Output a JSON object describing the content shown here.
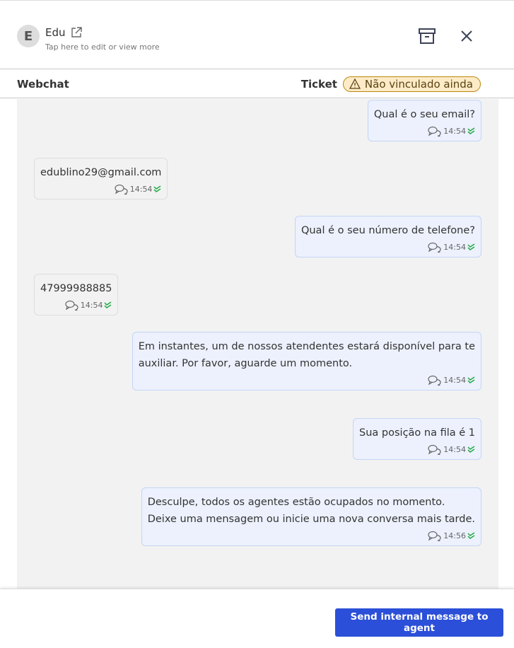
{
  "header": {
    "avatar_initial": "E",
    "contact_name": "Edu",
    "subtitle": "Tap here to edit or view more"
  },
  "tabbar": {
    "channel": "Webchat",
    "ticket_label": "Ticket",
    "ticket_status": "Não vinculado ainda"
  },
  "messages": [
    {
      "direction": "out",
      "lines": [
        "Qual é o seu email?"
      ],
      "time": "14:54"
    },
    {
      "direction": "in",
      "lines": [
        "edublino29@gmail.com"
      ],
      "time": "14:54"
    },
    {
      "direction": "out",
      "lines": [
        "Qual é o seu número de telefone?"
      ],
      "time": "14:54"
    },
    {
      "direction": "in",
      "lines": [
        "47999988885"
      ],
      "time": "14:54"
    },
    {
      "direction": "out",
      "lines": [
        "Em instantes, um de nossos atendentes estará disponível para te",
        "auxiliar. Por favor, aguarde um momento."
      ],
      "time": "14:54"
    },
    {
      "direction": "out",
      "lines": [
        "Sua posição na fila é 1"
      ],
      "time": "14:54"
    },
    {
      "direction": "out",
      "lines": [
        "Desculpe, todos os agentes estão ocupados no momento.",
        "Deixe uma mensagem ou inicie uma nova conversa mais tarde."
      ],
      "time": "14:56"
    }
  ],
  "footer": {
    "send_label": "Send internal message to agent"
  },
  "colors": {
    "accent": "#2b4fd8",
    "badge_bg": "#fdebc8",
    "read_check": "#22aa44"
  }
}
